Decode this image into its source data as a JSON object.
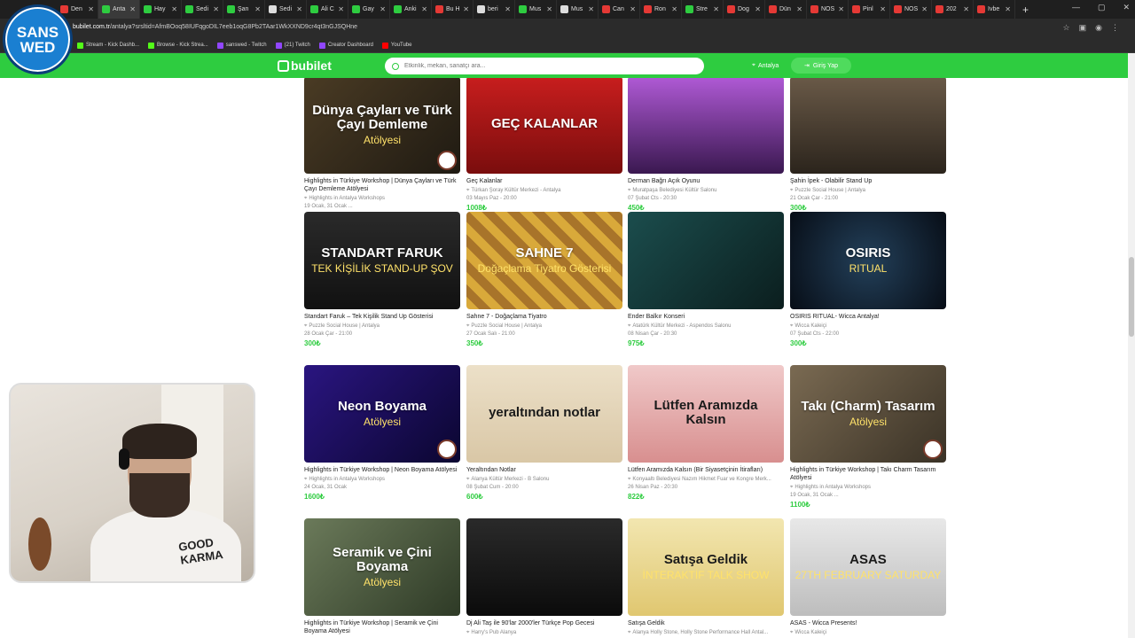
{
  "browser": {
    "tabs": [
      {
        "label": "Den",
        "color": "#e53935",
        "active": false
      },
      {
        "label": "Anta",
        "color": "#2ecc40",
        "active": true
      },
      {
        "label": "Hay",
        "color": "#2ecc40",
        "active": false
      },
      {
        "label": "Sedi",
        "color": "#2ecc40",
        "active": false
      },
      {
        "label": "Şan",
        "color": "#2ecc40",
        "active": false
      },
      {
        "label": "Sedi",
        "color": "#dddddd",
        "active": false
      },
      {
        "label": "Ali C",
        "color": "#2ecc40",
        "active": false
      },
      {
        "label": "Gay",
        "color": "#2ecc40",
        "active": false
      },
      {
        "label": "Anki",
        "color": "#2ecc40",
        "active": false
      },
      {
        "label": "Bu H",
        "color": "#e53935",
        "active": false
      },
      {
        "label": "beri",
        "color": "#dddddd",
        "active": false
      },
      {
        "label": "Mus",
        "color": "#2ecc40",
        "active": false
      },
      {
        "label": "Mus",
        "color": "#dddddd",
        "active": false
      },
      {
        "label": "Can",
        "color": "#e53935",
        "active": false
      },
      {
        "label": "Ron",
        "color": "#e53935",
        "active": false
      },
      {
        "label": "Stre",
        "color": "#2ecc40",
        "active": false
      },
      {
        "label": "Dog",
        "color": "#e53935",
        "active": false
      },
      {
        "label": "Dün",
        "color": "#e53935",
        "active": false
      },
      {
        "label": "NOS",
        "color": "#e53935",
        "active": false
      },
      {
        "label": "Pinl",
        "color": "#e53935",
        "active": false
      },
      {
        "label": "NOS",
        "color": "#e53935",
        "active": false
      },
      {
        "label": "202",
        "color": "#e53935",
        "active": false
      },
      {
        "label": "Ivbe",
        "color": "#e53935",
        "active": false
      }
    ],
    "url_domain": "bubilet.com.tr",
    "url_path": "/antalya?srsltid=AfmBOoq58IUFqgoDIL7eeb1oqG8Pb2TAar1WkXXND9cr4qt3nGJSQHne",
    "bookmarks": [
      {
        "label": "Stream - Kick Dashb...",
        "color": "#53fc18"
      },
      {
        "label": "Browse - Kick Strea...",
        "color": "#53fc18"
      },
      {
        "label": "sanswed - Twitch",
        "color": "#9146ff"
      },
      {
        "label": "(21) Twitch",
        "color": "#9146ff"
      },
      {
        "label": "Creator Dashboard",
        "color": "#9146ff"
      },
      {
        "label": "YouTube",
        "color": "#ff0000"
      }
    ]
  },
  "site": {
    "logo": "bubilet",
    "search_placeholder": "Etkinlik, mekan, sanatçı ara...",
    "location": "Antalya",
    "login": "Giriş Yap"
  },
  "channel_logo": {
    "line1": "SANS",
    "line2": "WED"
  },
  "webcam": {
    "shirt_text": "GOOD KARMA"
  },
  "events": [
    {
      "title": "Highlights in Türkiye Workshop | Dünya Çayları ve Türk Çayı Demleme Atölyesi",
      "venue": "Highlights in Antalya Workshops",
      "date": "19 Ocak, 31 Ocak ...",
      "price": "1000₺",
      "art_title": "Dünya Çayları ve Türk Çayı Demleme",
      "art_sub": "Atölyesi",
      "bg": "linear-gradient(135deg,#4a3b24,#1f1a12)"
    },
    {
      "title": "Geç Kalanlar",
      "venue": "Türkan Şoray Kültür Merkezi - Antalya",
      "date": "03 Mayıs Paz - 20:00",
      "price": "1008₺",
      "art_title": "GEÇ KALANLAR",
      "art_sub": "",
      "bg": "linear-gradient(180deg,#c81e1e,#7a0d0d)"
    },
    {
      "title": "Derman Bağrı Açık Oyunu",
      "venue": "Muratpaşa Belediyesi Kültür Salonu",
      "date": "07 Şubat Cts - 20:30",
      "price": "450₺",
      "art_title": "",
      "art_sub": "",
      "bg": "linear-gradient(180deg,#b05ad6,#3a1850)"
    },
    {
      "title": "Şahin İpek - Olabilir Stand Up",
      "venue": "Puzzle Social House | Antalya",
      "date": "21 Ocak Çar - 21:00",
      "price": "300₺",
      "art_title": "",
      "art_sub": "",
      "bg": "linear-gradient(180deg,#6a5a48,#2b241c)"
    },
    {
      "title": "Standart Faruk – Tek Kişilik Stand Up Gösterisi",
      "venue": "Puzzle Social House | Antalya",
      "date": "28 Ocak Çar - 21:00",
      "price": "300₺",
      "art_title": "STANDART FARUK",
      "art_sub": "TEK KİŞİLİK STAND-UP ŞOV",
      "bg": "linear-gradient(180deg,#2a2a2a,#111)"
    },
    {
      "title": "Sahne 7 - Doğaçlama Tiyatro",
      "venue": "Puzzle Social House | Antalya",
      "date": "27 Ocak Salı - 21:00",
      "price": "350₺",
      "art_title": "SAHNE 7",
      "art_sub": "Doğaçlama Tiyatro Gösterisi",
      "bg": "repeating-linear-gradient(45deg,#d9a93a 0 10px,#a8742a 10px 20px)"
    },
    {
      "title": "Ender Balkır Konseri",
      "venue": "Atatürk Kültür Merkezi - Aspendos Salonu",
      "date": "08 Nisan Çar - 20:30",
      "price": "975₺",
      "art_title": "",
      "art_sub": "",
      "bg": "linear-gradient(135deg,#1b4d4d,#0b1e1e)"
    },
    {
      "title": "OSIRIS RITUAL- Wicca Antalya!",
      "venue": "Wicca Kaleiçi",
      "date": "07 Şubat Cts - 22:00",
      "price": "300₺",
      "art_title": "OSIRIS",
      "art_sub": "RITUAL",
      "bg": "radial-gradient(circle,#23405a,#070d16)"
    },
    {
      "title": "Highlights in Türkiye Workshop | Neon Boyama Atölyesi",
      "venue": "Highlights in Antalya Workshops",
      "date": "24 Ocak, 31 Ocak",
      "price": "1600₺",
      "art_title": "Neon Boyama",
      "art_sub": "Atölyesi",
      "bg": "linear-gradient(135deg,#2a1580,#0b0630)"
    },
    {
      "title": "Yeraltından Notlar",
      "venue": "Alanya Kültür Merkezi - B Salonu",
      "date": "08 Şubat Cum - 20:00",
      "price": "600₺",
      "art_title": "yeraltından notlar",
      "art_sub": "",
      "bg": "linear-gradient(180deg,#ece0c8,#d9c7a6)"
    },
    {
      "title": "Lütfen Aramızda Kalsın (Bir Siyasetçinin İtirafları)",
      "venue": "Konyaaltı Belediyesi Nazım Hikmet Fuar ve Kongre Merk...",
      "date": "26 Nisan Paz - 20:30",
      "price": "822₺",
      "art_title": "Lütfen Aramızda Kalsın",
      "art_sub": "",
      "bg": "linear-gradient(180deg,#f0c9c9,#d88f8f)"
    },
    {
      "title": "Highlights in Türkiye Workshop | Takı Charm Tasarım Atölyesi",
      "venue": "Highlights in Antalya Workshops",
      "date": "19 Ocak, 31 Ocak ...",
      "price": "1100₺",
      "art_title": "Takı (Charm) Tasarım",
      "art_sub": "Atölyesi",
      "bg": "linear-gradient(135deg,#7a6a52,#3a3226)"
    },
    {
      "title": "Highlights in Türkiye Workshop | Seramik ve Çini Boyama Atölyesi",
      "venue": "",
      "date": "",
      "price": "",
      "art_title": "Seramik ve Çini Boyama",
      "art_sub": "Atölyesi",
      "bg": "linear-gradient(135deg,#6b7a5a,#2e3a26)"
    },
    {
      "title": "Dj Ali Taş ile 90'lar 2000'ler Türkçe Pop Gecesi",
      "venue": "Harry's Pub Alanya",
      "date": "",
      "price": "",
      "art_title": "",
      "art_sub": "",
      "bg": "linear-gradient(180deg,#2a2a2a,#0b0b0b)"
    },
    {
      "title": "Satışa Geldik",
      "venue": "Alanya Holly Stone, Holly Stone Performance Hall Antal...",
      "date": "",
      "price": "",
      "art_title": "Satışa Geldik",
      "art_sub": "İNTERAKTİF TALK SHOW",
      "bg": "linear-gradient(180deg,#f2e6b0,#e0c770)"
    },
    {
      "title": "ASAS - Wicca Presents!",
      "venue": "Wicca Kaleiçi",
      "date": "",
      "price": "",
      "art_title": "ASAS",
      "art_sub": "27TH FEBRUARY SATURDAY",
      "bg": "linear-gradient(180deg,#e8e8e8,#bdbdbd)"
    }
  ]
}
